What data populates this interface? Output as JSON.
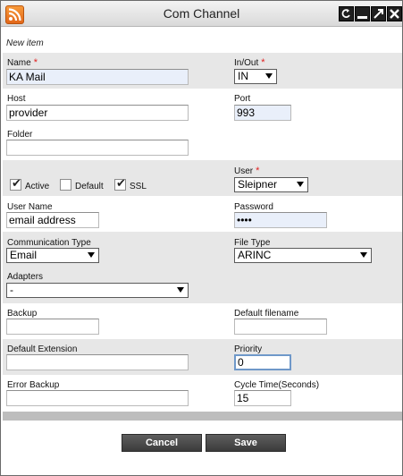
{
  "window": {
    "title": "Com Channel"
  },
  "form": {
    "section_title": "New item",
    "name": {
      "label": "Name",
      "value": "KA Mail"
    },
    "in_out": {
      "label": "In/Out",
      "value": "IN"
    },
    "host": {
      "label": "Host",
      "value": "provider"
    },
    "port": {
      "label": "Port",
      "value": "993"
    },
    "folder": {
      "label": "Folder",
      "value": ""
    },
    "active": {
      "label": "Active",
      "checked": true
    },
    "default": {
      "label": "Default",
      "checked": false
    },
    "ssl": {
      "label": "SSL",
      "checked": true
    },
    "user": {
      "label": "User",
      "value": "Sleipner"
    },
    "user_name": {
      "label": "User Name",
      "value": "email address"
    },
    "password": {
      "label": "Password",
      "value": "••••"
    },
    "communication_type": {
      "label": "Communication Type",
      "value": "Email"
    },
    "file_type": {
      "label": "File Type",
      "value": "ARINC"
    },
    "adapters": {
      "label": "Adapters",
      "value": "-"
    },
    "backup": {
      "label": "Backup",
      "value": ""
    },
    "default_filename": {
      "label": "Default filename",
      "value": ""
    },
    "default_extension": {
      "label": "Default Extension",
      "value": ""
    },
    "priority": {
      "label": "Priority",
      "value": "0"
    },
    "error_backup": {
      "label": "Error Backup",
      "value": ""
    },
    "cycle_time": {
      "label": "Cycle Time(Seconds)",
      "value": "15"
    },
    "required_mark": "*"
  },
  "buttons": {
    "cancel": "Cancel",
    "save": "Save"
  },
  "icons": {
    "rss": "rss-icon",
    "refresh": "refresh-icon",
    "minimize": "minimize-icon",
    "maximize": "maximize-icon",
    "close": "close-icon"
  },
  "colors": {
    "required": "#e02020",
    "gray_band": "#e7e7e7",
    "button": "#4a4a4a"
  }
}
